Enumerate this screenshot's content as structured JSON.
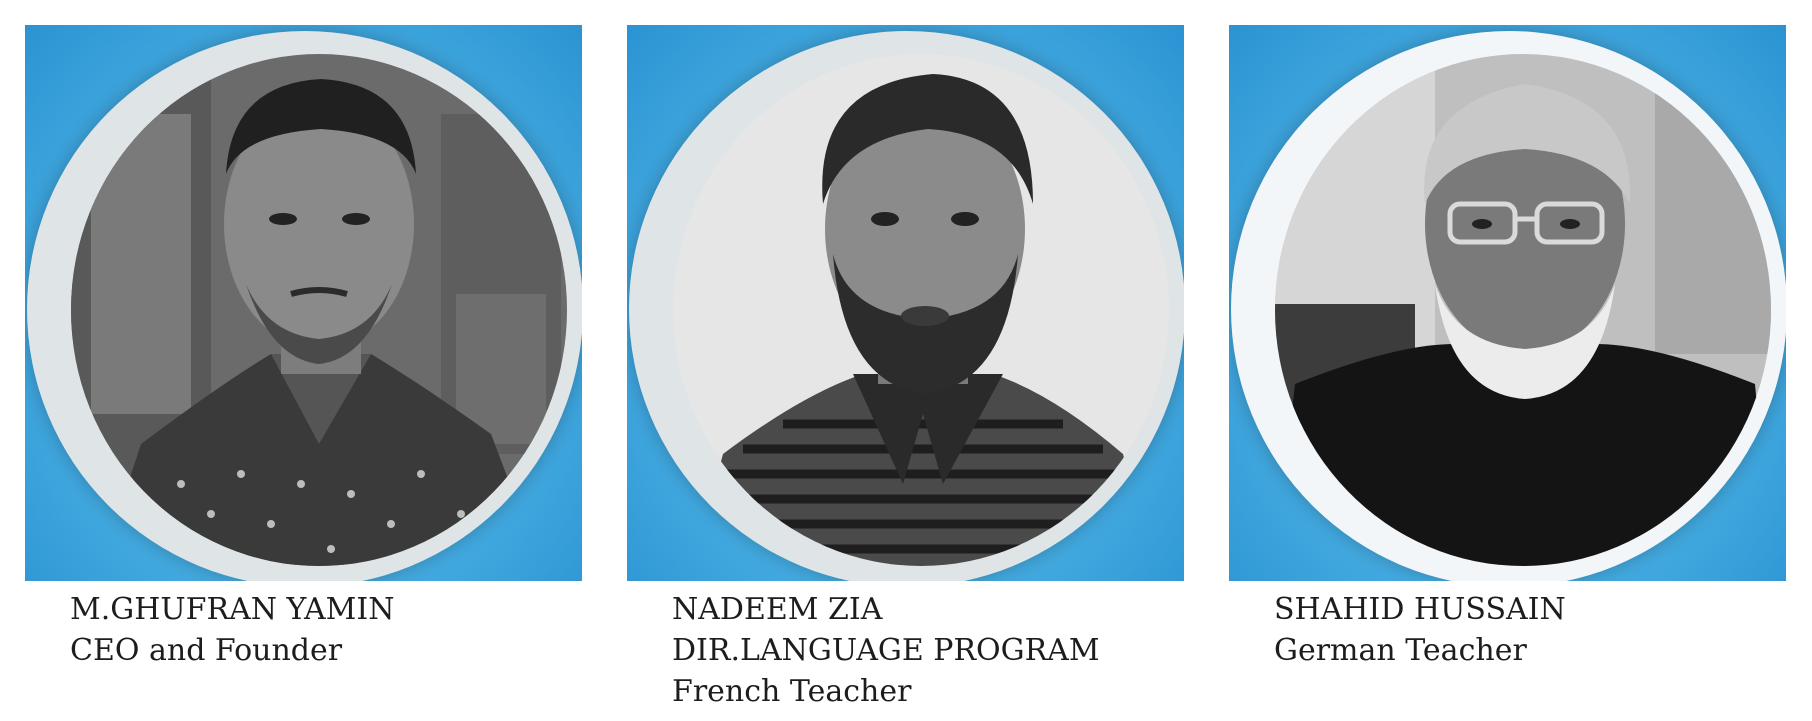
{
  "team": [
    {
      "name": "M.GHUFRAN YAMIN",
      "roles": [
        "CEO and Founder"
      ],
      "portrait_icon": "person-portrait-icon"
    },
    {
      "name": "NADEEM ZIA",
      "roles": [
        "DIR.LANGUAGE PROGRAM",
        "French Teacher"
      ],
      "portrait_icon": "person-portrait-icon"
    },
    {
      "name": "SHAHID HUSSAIN",
      "roles": [
        "German Teacher"
      ],
      "portrait_icon": "person-portrait-icon"
    }
  ],
  "colors": {
    "background": "#2a93d2",
    "ring": "#dfe4e7",
    "text": "#1d1d1d"
  }
}
